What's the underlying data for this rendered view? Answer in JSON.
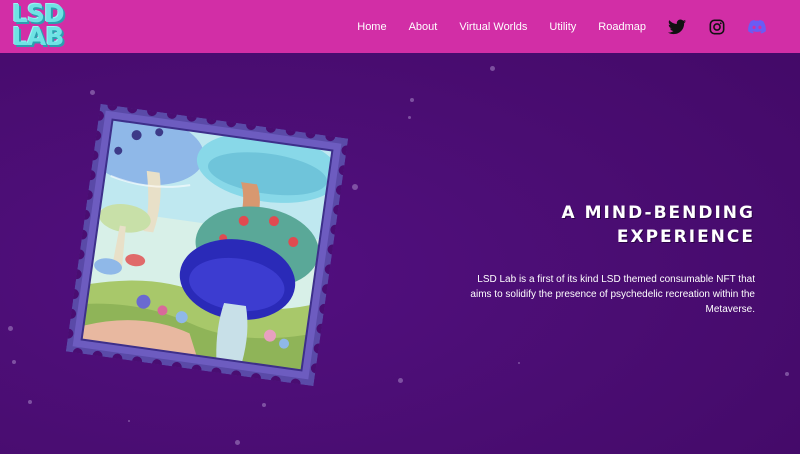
{
  "brand": {
    "logo_line1": "LSD",
    "logo_line2": "LAB"
  },
  "nav": {
    "items": [
      {
        "label": "Home"
      },
      {
        "label": "About"
      },
      {
        "label": "Virtual Worlds"
      },
      {
        "label": "Utility"
      },
      {
        "label": "Roadmap"
      }
    ],
    "social": [
      {
        "icon": "twitter-icon"
      },
      {
        "icon": "instagram-icon"
      },
      {
        "icon": "discord-icon"
      }
    ]
  },
  "hero": {
    "headline_line1": "A MIND-BENDING",
    "headline_line2": "EXPERIENCE",
    "description": "LSD Lab is a first of its kind LSD themed consumable NFT that aims to solidify the presence of psychedelic recreation within the Metaverse."
  },
  "colors": {
    "header": "#d22ea6",
    "background": "#4a0d72",
    "logo": "#6fe3e4",
    "discord": "#6a5cf5"
  }
}
